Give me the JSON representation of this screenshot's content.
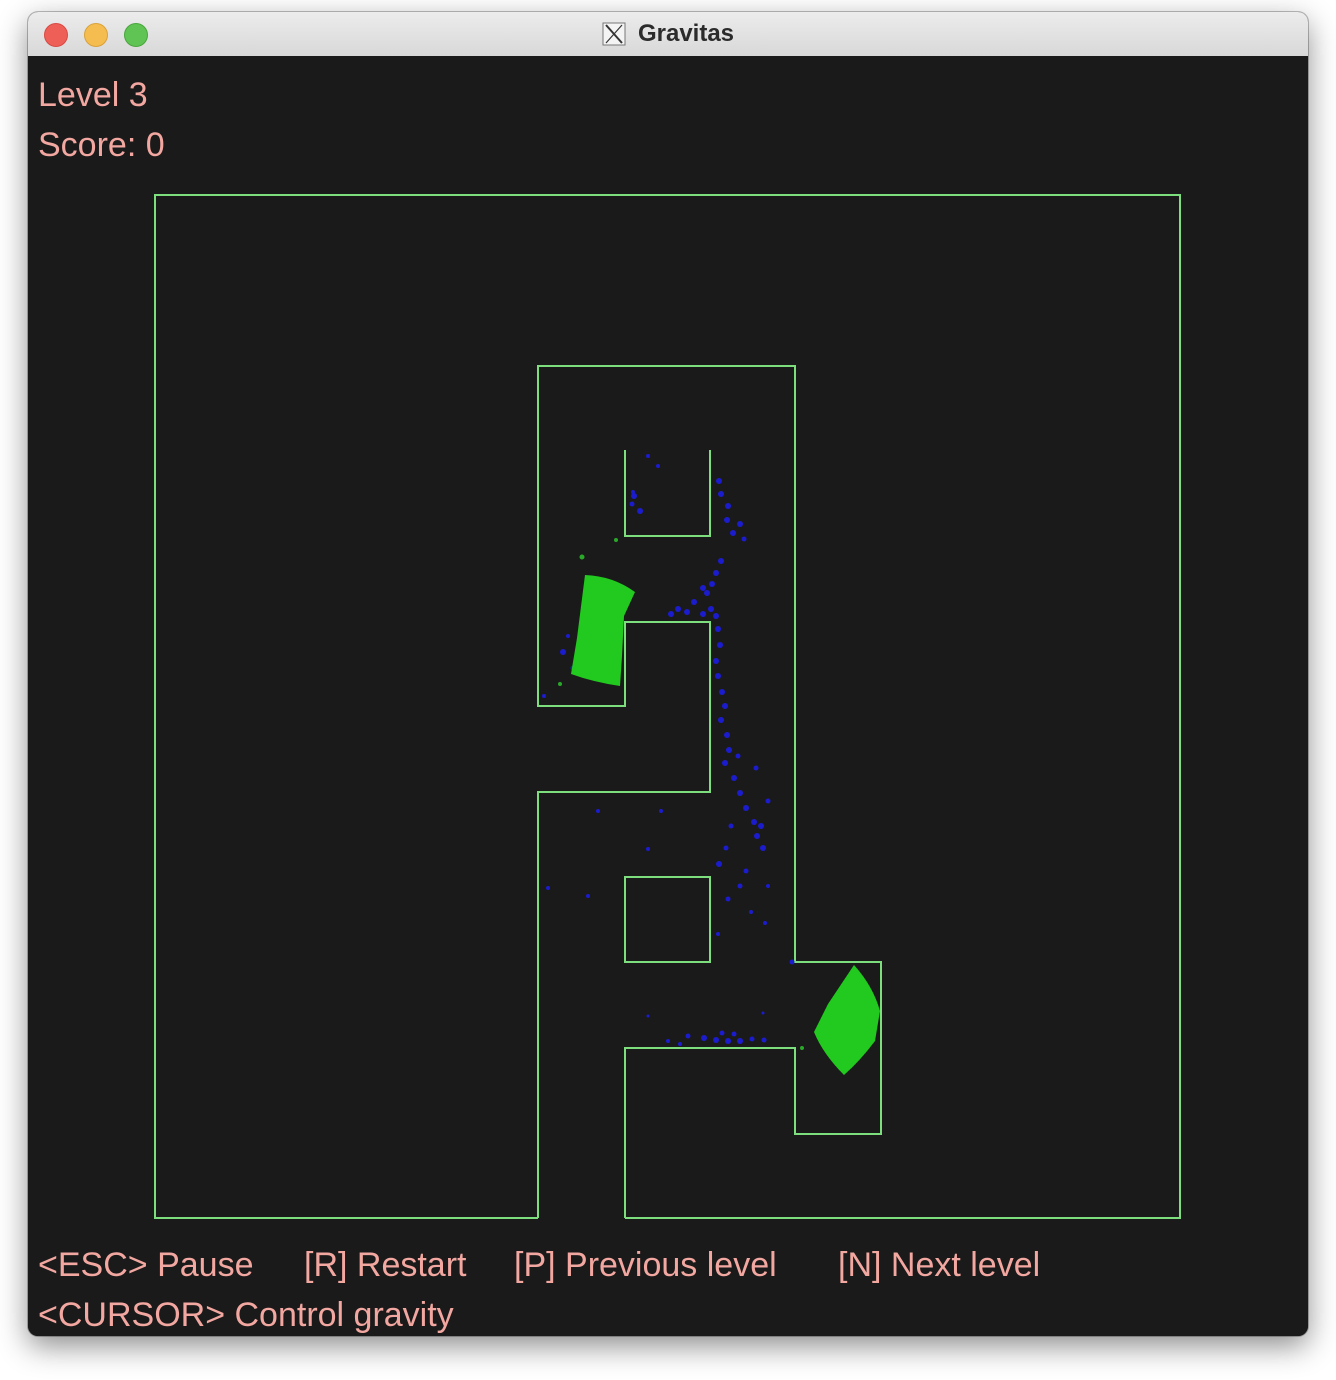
{
  "window": {
    "title": "Gravitas",
    "buttons": [
      "close",
      "minimize",
      "maximize"
    ],
    "app_icon": "x11-icon"
  },
  "hud": {
    "level": "Level 3",
    "score": "Score: 0"
  },
  "controls": {
    "pause": "<ESC> Pause",
    "restart": "[R] Restart",
    "previous": "[P] Previous level",
    "next": "[N] Next level",
    "gravity": "<CURSOR> Control gravity"
  },
  "colors": {
    "background": "#1a1a1a",
    "wall": "#7dde7d",
    "text": "#f2a7a1",
    "green_liquid": "#22c91f",
    "blue_particles": "#1c1ccf"
  }
}
